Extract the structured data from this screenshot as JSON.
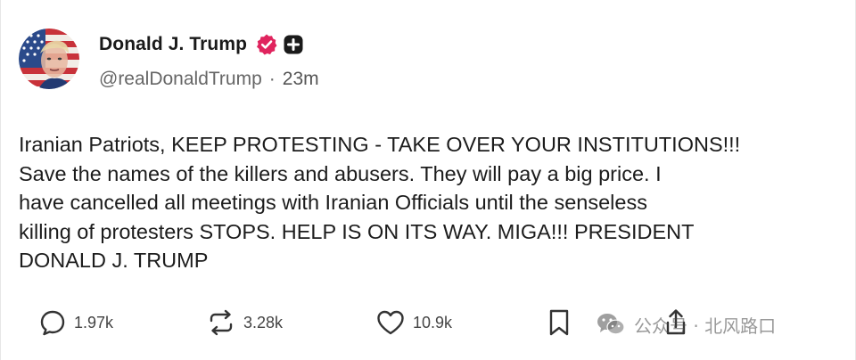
{
  "post": {
    "author": {
      "display_name": "Donald J. Trump",
      "handle": "@realDonaldTrump",
      "avatar_icon": "flag-portrait-avatar",
      "verified_icon": "verified-badge-icon",
      "verified_color": "#e0245e"
    },
    "separator": "·",
    "timestamp": "23m",
    "text": "Iranian Patriots, KEEP PROTESTING - TAKE OVER YOUR INSTITUTIONS!!!\nSave the names of the killers and abusers. They will pay a big price. I\nhave cancelled all meetings with Iranian Officials until the senseless\nkilling of protesters STOPS. HELP IS ON ITS WAY. MIGA!!! PRESIDENT\nDONALD J. TRUMP",
    "actions": {
      "replies": {
        "icon": "reply-icon",
        "count": "1.97k"
      },
      "retruths": {
        "icon": "repost-icon",
        "count": "3.28k"
      },
      "likes": {
        "icon": "heart-icon",
        "count": "10.9k"
      },
      "bookmark": {
        "icon": "bookmark-icon"
      },
      "share": {
        "icon": "share-icon"
      }
    }
  },
  "watermark": {
    "icon": "wechat-icon",
    "text": "公众号 · 北风路口"
  }
}
